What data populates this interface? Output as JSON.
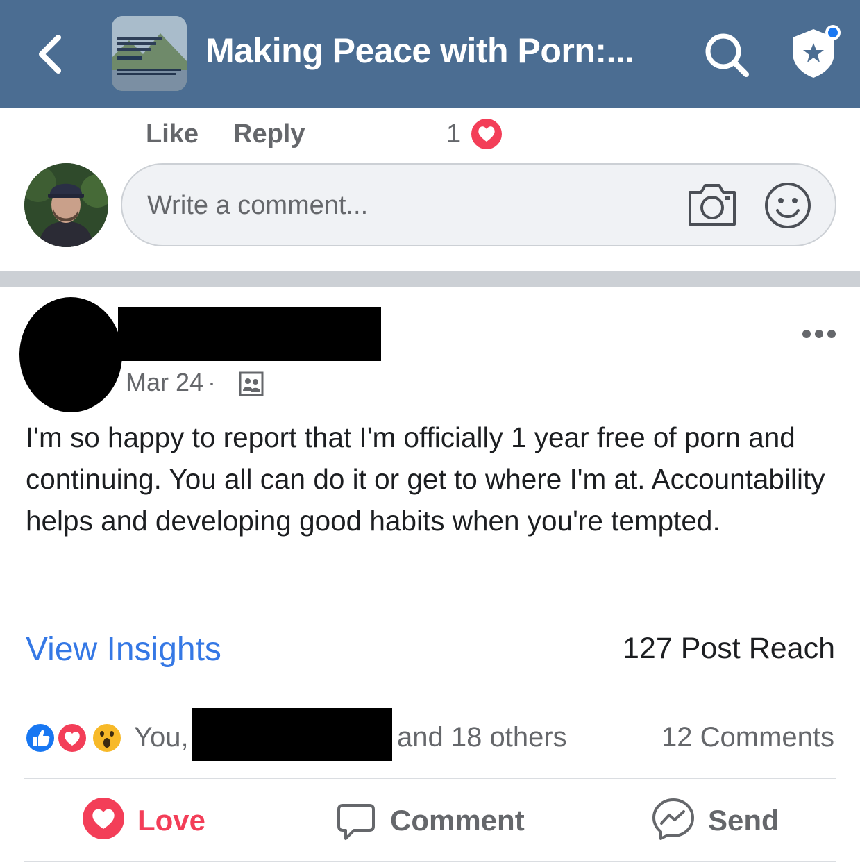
{
  "header": {
    "title": "Making Peace with Porn:...",
    "background_color": "#4b6d92",
    "back_icon": "chevron-left-icon",
    "search_icon": "search-icon",
    "admin_icon": "shield-star-icon"
  },
  "previous_comment": {
    "like_label": "Like",
    "reply_label": "Reply",
    "reaction_count": "1",
    "reaction_icon": "heart-icon"
  },
  "composer": {
    "placeholder": "Write a comment...",
    "camera_icon": "camera-icon",
    "emoji_icon": "smiley-icon"
  },
  "post": {
    "date": "Mar 24",
    "separator": "·",
    "audience_icon": "group-members-icon",
    "body": "I'm so happy to report that I'm officially 1 year free of porn and continuing. You all can do it or get to where I'm at. Accountability helps and developing good habits when you're tempted.",
    "view_insights_label": "View Insights",
    "post_reach": "127 Post Reach",
    "reactions_you": "You,",
    "reactions_others": "and 18 others",
    "comments_count": "12 Comments",
    "more_icon": "more-dots-icon"
  },
  "actions": {
    "love_label": "Love",
    "comment_label": "Comment",
    "send_label": "Send"
  },
  "colors": {
    "accent_blue": "#3578e5",
    "love_red": "#f33e58",
    "muted_text": "#65676b"
  }
}
